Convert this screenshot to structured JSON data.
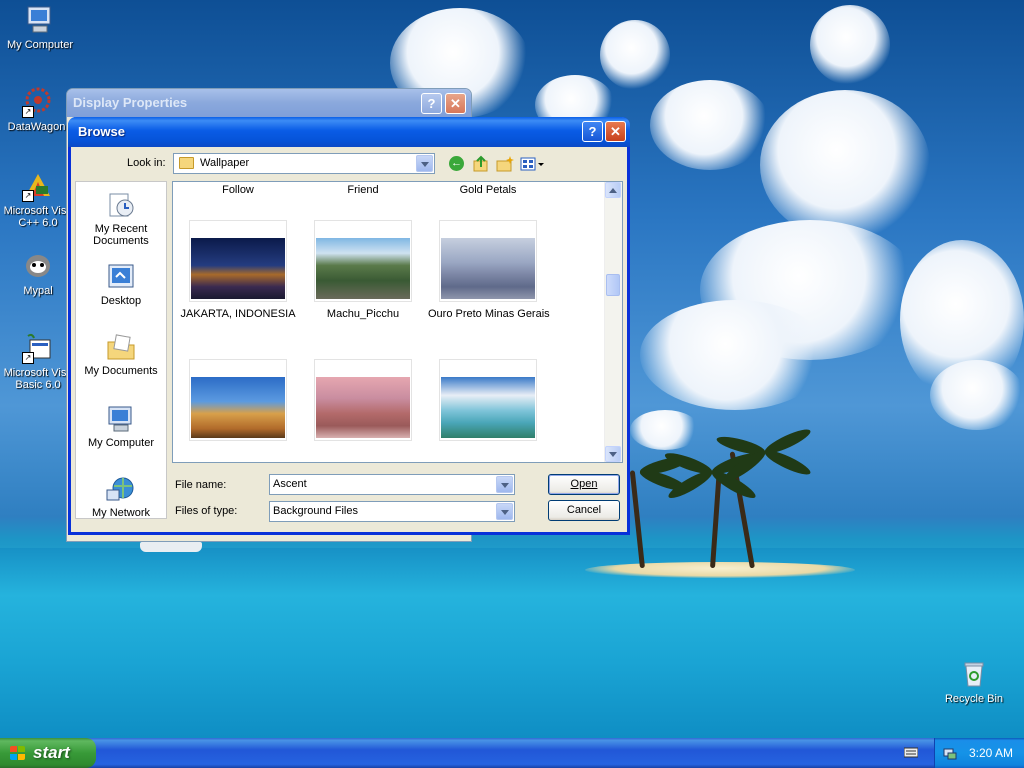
{
  "desktop": {
    "icons": [
      {
        "label": "My Computer",
        "icon": "my-computer-icon"
      },
      {
        "label": "DataWagon.",
        "icon": "datawagon-icon"
      },
      {
        "label": "Microsoft Visu C++ 6.0",
        "icon": "visual-cpp-icon"
      },
      {
        "label": "Mypal",
        "icon": "mypal-icon"
      },
      {
        "label": "Microsoft Visu Basic 6.0",
        "icon": "visual-basic-icon"
      },
      {
        "label": "Recycle Bin",
        "icon": "recycle-bin-icon"
      }
    ]
  },
  "display_properties": {
    "title": "Display Properties",
    "help_label": "?",
    "close_label": "✕"
  },
  "browse": {
    "title": "Browse",
    "help_label": "?",
    "close_label": "✕",
    "look_in_label": "Look in:",
    "look_in_value": "Wallpaper",
    "places": [
      {
        "label": "My Recent Documents",
        "icon": "recent-documents-icon"
      },
      {
        "label": "Desktop",
        "icon": "desktop-icon"
      },
      {
        "label": "My Documents",
        "icon": "my-documents-icon"
      },
      {
        "label": "My Computer",
        "icon": "my-computer-icon"
      },
      {
        "label": "My Network",
        "icon": "my-network-icon"
      }
    ],
    "top_captions": [
      "Follow",
      "Friend",
      "Gold Petals"
    ],
    "files": [
      {
        "name": "JAKARTA, INDONESIA"
      },
      {
        "name": "Machu_Picchu"
      },
      {
        "name": "Ouro Preto Minas Gerais"
      },
      {
        "name": ""
      },
      {
        "name": ""
      },
      {
        "name": ""
      }
    ],
    "file_name_label": "File name:",
    "file_name_value": "Ascent",
    "file_type_label": "Files of type:",
    "file_type_value": "Background Files",
    "open_label": "Open",
    "cancel_label": "Cancel"
  },
  "taskbar": {
    "start_label": "start",
    "clock": "3:20 AM"
  },
  "colors": {
    "title_blue": "#0a5ce6",
    "close_red": "#c7411c",
    "start_green": "#389a38",
    "dialog_bg": "#ece9d8"
  }
}
